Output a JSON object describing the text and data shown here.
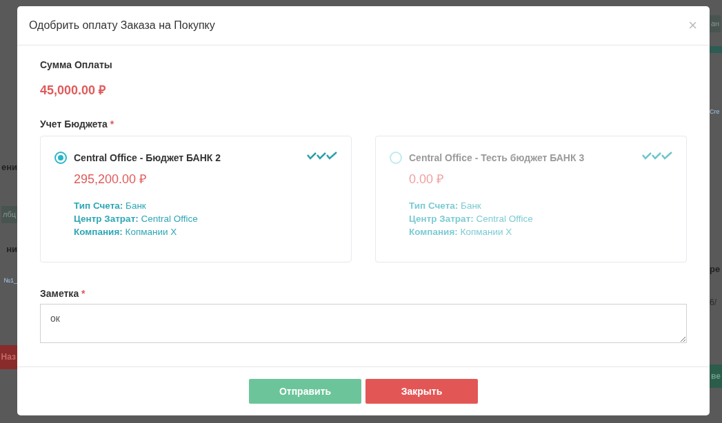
{
  "background": {
    "left": [
      {
        "kind": "heading",
        "text": "ени"
      },
      {
        "kind": "badge",
        "text": "лбц"
      },
      {
        "kind": "header-cell",
        "text": "ни"
      },
      {
        "kind": "link",
        "text": "№1_"
      },
      {
        "kind": "danger-button",
        "text": "Наз"
      }
    ],
    "right": [
      {
        "kind": "badge",
        "text": "ан"
      },
      {
        "kind": "link",
        "text": "Cre"
      },
      {
        "kind": "header-cell",
        "text": "ре"
      },
      {
        "kind": "cell",
        "text": "6/"
      },
      {
        "kind": "success-button",
        "text": "ве"
      }
    ]
  },
  "dialog": {
    "title": "Одобрить оплату Заказа на Покупку",
    "close": "×",
    "amount_label": "Сумма Оплаты",
    "amount": "45,000.00 ₽",
    "budget_label": "Учет Бюджета",
    "budget_required": "*",
    "budgets": [
      {
        "title": "Central Office - Бюджет БАНК 2",
        "amount": "295,200.00 ₽",
        "selected": true,
        "fields": [
          {
            "label": "Тип Счета:",
            "value": "Банк"
          },
          {
            "label": "Центр Затрат:",
            "value": "Central Office"
          },
          {
            "label": "Компания:",
            "value": "Копмании X"
          }
        ]
      },
      {
        "title": "Central Office - Тесть бюджет БАНК 3",
        "amount": "0.00 ₽",
        "selected": false,
        "fields": [
          {
            "label": "Тип Счета:",
            "value": "Банк"
          },
          {
            "label": "Центр Затрат:",
            "value": "Central Office"
          },
          {
            "label": "Компания:",
            "value": "Копмании X"
          }
        ]
      }
    ],
    "note_label": "Заметка",
    "note_required": "*",
    "note_value": "ок",
    "buttons": [
      {
        "label": "Отправить",
        "kind": "primary"
      },
      {
        "label": "Закрыть",
        "kind": "danger"
      }
    ]
  }
}
